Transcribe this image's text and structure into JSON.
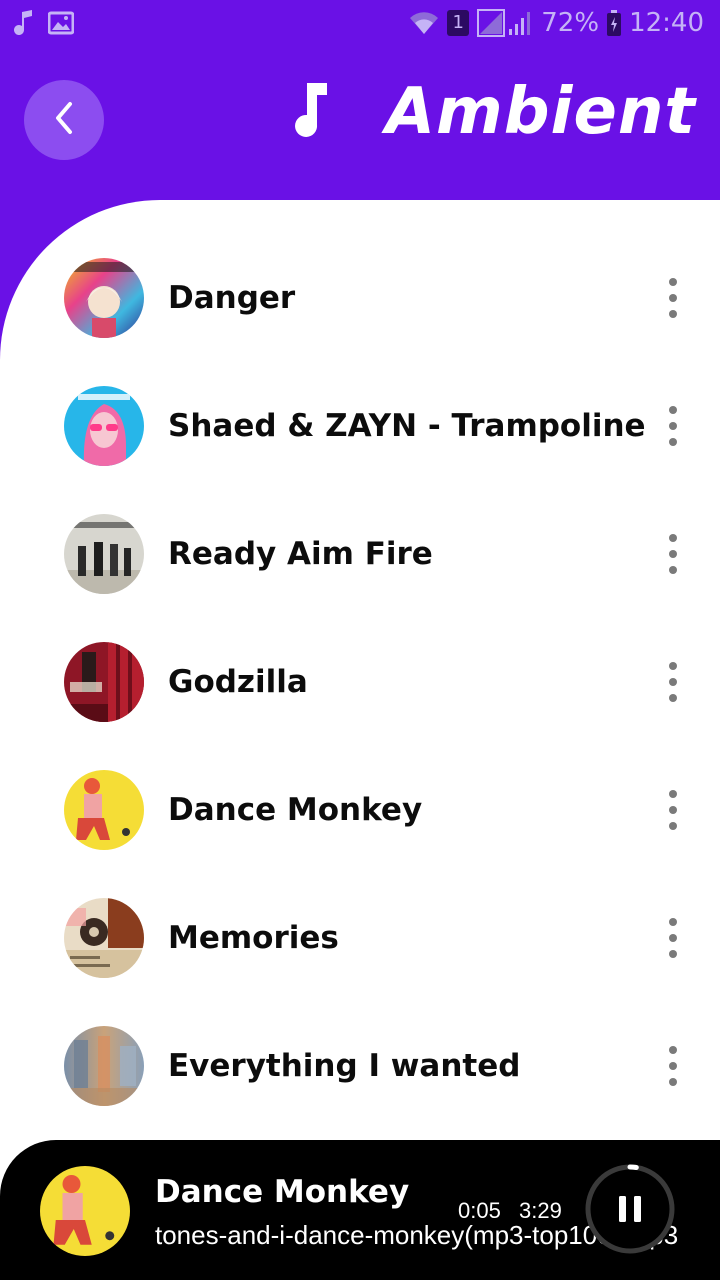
{
  "colors": {
    "accent": "#6a11e6",
    "back_button": "#8c4df0",
    "player_bg": "#000000"
  },
  "status_bar": {
    "left_icons": [
      "music-note-icon",
      "gallery-icon"
    ],
    "right_icons": [
      "wifi-icon",
      "sim-icon",
      "signal-icon",
      "battery-icon"
    ],
    "sim_label": "1",
    "battery": "72%",
    "time": "12:40"
  },
  "header": {
    "back_icon": "chevron-left-icon",
    "title_icon": "music-note-icon",
    "title": "Ambient"
  },
  "songs": [
    {
      "title": "Danger",
      "cover_icon": "album-cover"
    },
    {
      "title": "Shaed & ZAYN - Trampoline",
      "cover_icon": "album-cover"
    },
    {
      "title": "Ready Aim Fire",
      "cover_icon": "album-cover"
    },
    {
      "title": "Godzilla",
      "cover_icon": "album-cover"
    },
    {
      "title": "Dance Monkey",
      "cover_icon": "album-cover"
    },
    {
      "title": "Memories",
      "cover_icon": "album-cover"
    },
    {
      "title": "Everything I wanted",
      "cover_icon": "album-cover"
    }
  ],
  "player": {
    "title": "Dance Monkey",
    "file": "tones-and-i-dance-monkey(mp3-top100).mp3",
    "elapsed": "0:05",
    "duration": "3:29",
    "progress": 0.024,
    "control_icon": "pause-icon"
  }
}
